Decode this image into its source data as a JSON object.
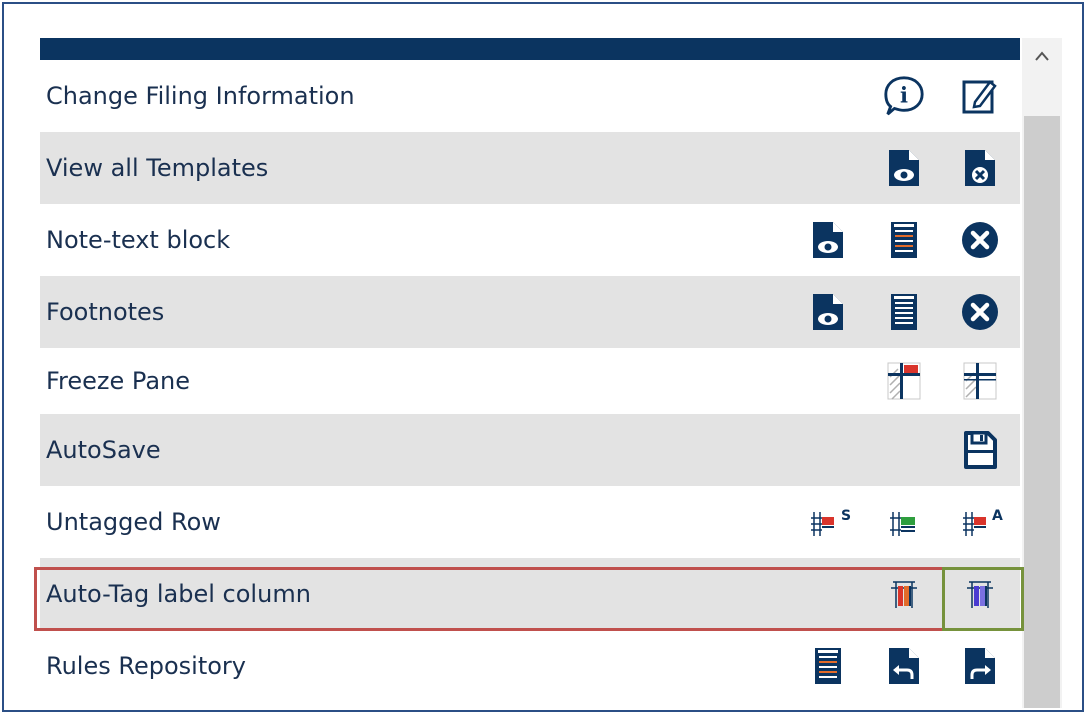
{
  "rows": [
    {
      "label": "Change Filing Information",
      "icons": [
        "info-bubble-icon",
        "edit-note-icon"
      ]
    },
    {
      "label": "View all Templates",
      "icons": [
        "document-view-icon",
        "document-close-icon"
      ]
    },
    {
      "label": "Note-text block",
      "icons": [
        "document-view-icon",
        "text-block-icon",
        "close-circle-icon"
      ]
    },
    {
      "label": "Footnotes",
      "icons": [
        "document-view-icon",
        "text-block-icon",
        "close-circle-icon"
      ]
    },
    {
      "label": "Freeze Pane",
      "icons": [
        "freeze-pane-red-icon",
        "freeze-pane-icon"
      ]
    },
    {
      "label": "AutoSave",
      "icons": [
        "save-icon"
      ]
    },
    {
      "label": "Untagged Row",
      "icons": [
        "untagged-row-s-icon",
        "untagged-row-green-icon",
        "untagged-row-a-icon"
      ]
    },
    {
      "label": "Auto-Tag label column",
      "icons": [
        "auto-tag-red-icon",
        "auto-tag-blue-icon"
      ]
    },
    {
      "label": "Rules Repository",
      "icons": [
        "text-block-icon",
        "document-undo-icon",
        "document-redo-icon"
      ]
    }
  ],
  "highlight_colors": {
    "row_outline": "#c0504d",
    "icon_outline": "#76923c"
  },
  "accent_color": "#0b3460"
}
